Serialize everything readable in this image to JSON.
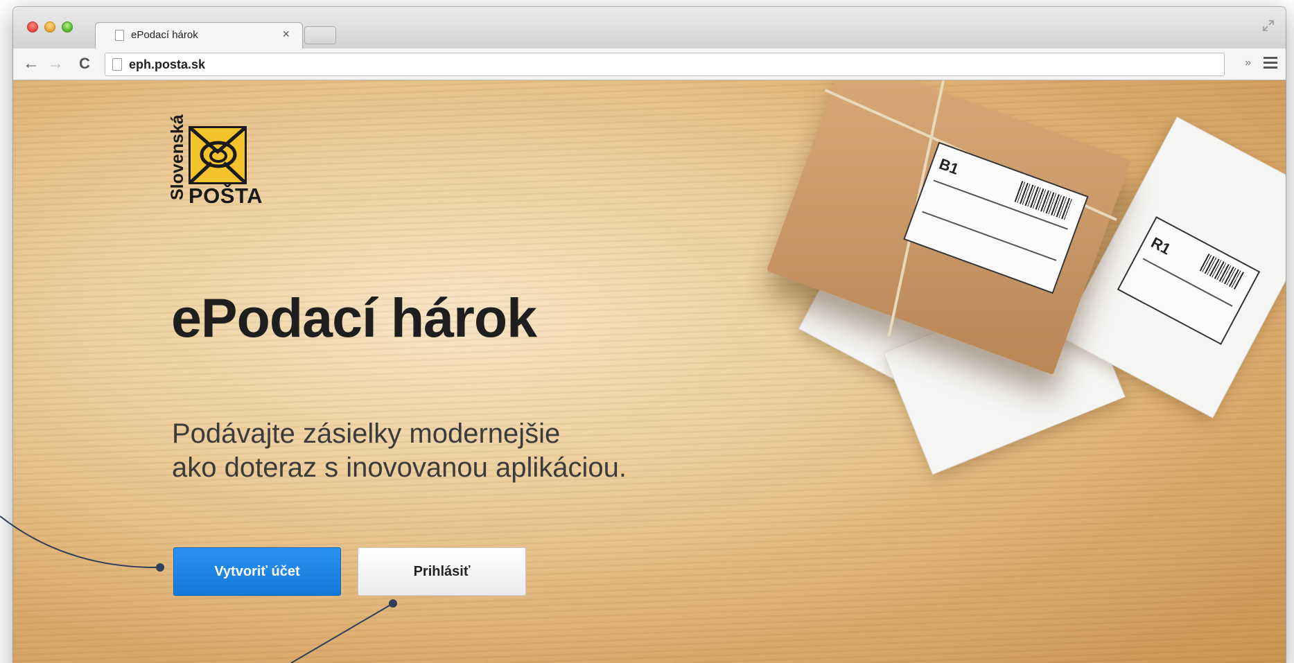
{
  "browser": {
    "tab_title": "ePodací hárok",
    "tab_close": "×",
    "address": "eph.posta.sk",
    "nav": {
      "back": "←",
      "forward": "→",
      "reload": "C"
    },
    "extensions_chevron": "»"
  },
  "logo": {
    "vertical_text": "Slovenská",
    "text": "POŠTA",
    "color": "#f4c22a"
  },
  "hero": {
    "title": "ePodací hárok",
    "subtitle_line1": "Podávajte zásielky modernejšie",
    "subtitle_line2": "ako doteraz s inovovanou aplikáciou."
  },
  "actions": {
    "create_account": "Vytvoriť účet",
    "login": "Prihlásiť"
  },
  "illustration": {
    "label_code_main": "B1",
    "label_code_side": "R1"
  },
  "colors": {
    "primary_button": "#1c80e4",
    "logo_yellow": "#f4c22a"
  }
}
